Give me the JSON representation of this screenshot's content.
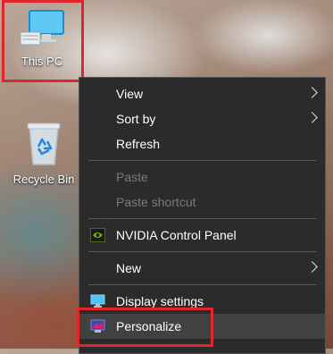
{
  "desktop": {
    "icons": [
      {
        "label": "This PC",
        "icon": "computer-icon"
      },
      {
        "label": "Recycle Bin",
        "icon": "recycle-bin-icon"
      }
    ]
  },
  "context_menu": {
    "items": [
      {
        "label": "View",
        "has_submenu": true
      },
      {
        "label": "Sort by",
        "has_submenu": true
      },
      {
        "label": "Refresh"
      },
      {
        "label": "Paste",
        "disabled": true
      },
      {
        "label": "Paste shortcut",
        "disabled": true
      },
      {
        "label": "NVIDIA Control Panel",
        "icon": "nvidia-icon"
      },
      {
        "label": "New",
        "has_submenu": true
      },
      {
        "label": "Display settings",
        "icon": "display-icon"
      },
      {
        "label": "Personalize",
        "icon": "personalize-icon",
        "highlighted": true
      }
    ]
  },
  "colors": {
    "highlight_box": "#e0262a",
    "menu_bg": "#2b2b2b",
    "menu_hover": "#414141"
  }
}
